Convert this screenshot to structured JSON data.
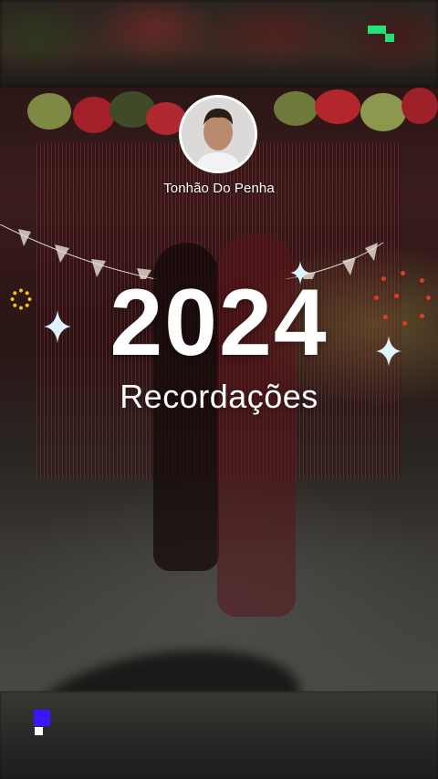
{
  "story": {
    "username": "Tonhão Do Penha",
    "year_text": "2024",
    "subtitle": "Recordações"
  },
  "icons": {
    "brand_mark": "green-pixel-logo-icon",
    "avatar": "profile-avatar",
    "bottom_badge": "blue-pixel-badge-icon",
    "sparkle": "four-point-star-icon"
  },
  "colors": {
    "brand_green": "#23e07a",
    "badge_blue": "#3a16ff",
    "text": "#ffffff"
  }
}
